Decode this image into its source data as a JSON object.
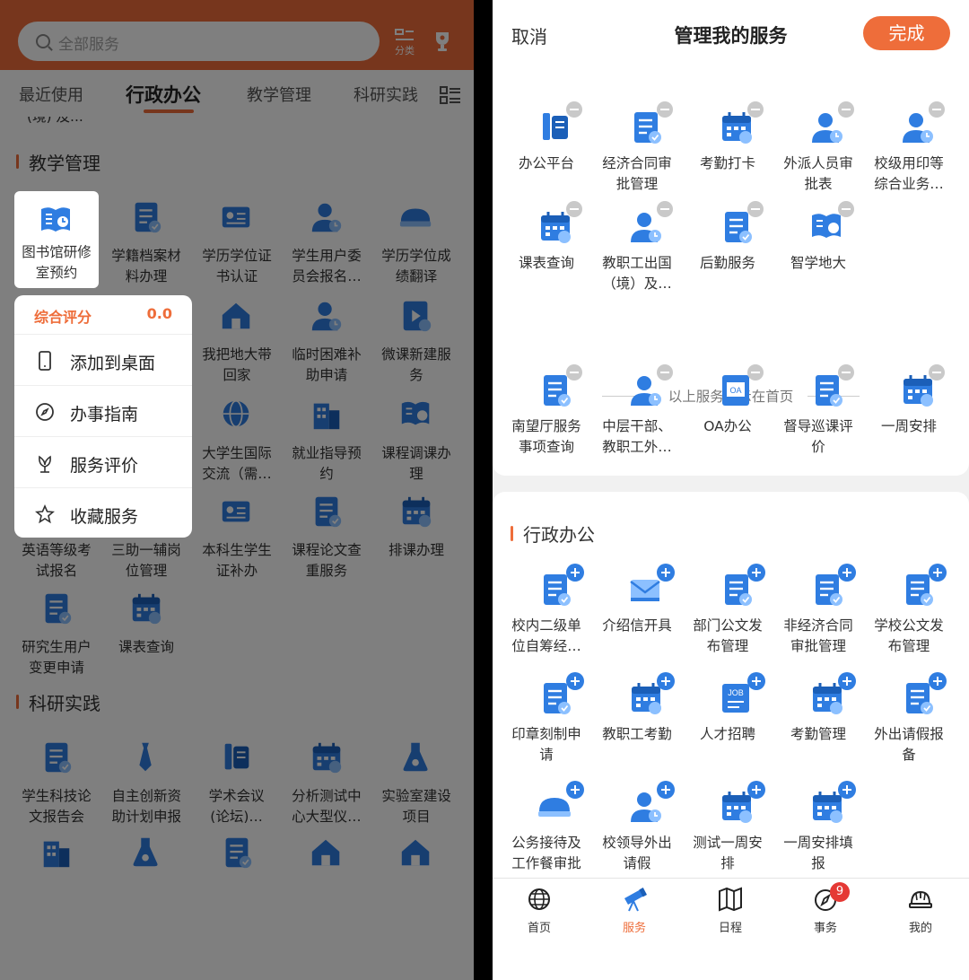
{
  "left": {
    "search_placeholder": "全部服务",
    "category_label": "分类",
    "tabs": [
      "最近使用",
      "行政办公",
      "教学管理",
      "科研实践"
    ],
    "partial_text": "(境) 及...",
    "teaching_section_title": "教学管理",
    "research_section_title": "科研实践",
    "teaching_items": [
      "学籍档案材\n料办理",
      "学历学位证\n书认证",
      "学生用户委\n员会报名…",
      "学历学位成\n绩翻译",
      "我把地大带\n回家",
      "临时困难补\n助申请",
      "微课新建服\n务",
      "大学生国际\n交流（需…",
      "就业指导预\n约",
      "课程调课办\n理",
      "英语等级考\n试报名",
      "三助一辅岗\n位管理",
      "本科生学生\n证补办",
      "课程论文查\n重服务",
      "排课办理",
      "研究生用户\n变更申请",
      "课表查询"
    ],
    "research_items": [
      "学生科技论\n文报告会",
      "自主创新资\n助计划申报",
      "学术会议\n(论坛)…",
      "分析测试中\n心大型仪…",
      "实验室建设\n项目"
    ],
    "highlight_item": "图书馆研修\n室预约",
    "popup": {
      "rating_label": "综合评分",
      "rating_value": "0.0",
      "items": [
        "添加到桌面",
        "办事指南",
        "服务评价",
        "收藏服务"
      ]
    }
  },
  "right": {
    "cancel": "取消",
    "title": "管理我的服务",
    "done": "完成",
    "my_services": [
      "办公平台",
      "经济合同审\n批管理",
      "考勤打卡",
      "外派人员审\n批表",
      "校级用印等\n综合业务…",
      "课表查询",
      "教职工出国\n（境）及…",
      "后勤服务",
      "智学地大"
    ],
    "divider_text": "以上服务显示在首页",
    "other_services": [
      "南望厅服务\n事项查询",
      "中层干部、\n教职工外…",
      "OA办公",
      "督导巡课评\n价",
      "一周安排"
    ],
    "section2_title": "行政办公",
    "section2_items": [
      "校内二级单\n位自筹经…",
      "介绍信开具",
      "部门公文发\n布管理",
      "非经济合同\n审批管理",
      "学校公文发\n布管理",
      "印章刻制申\n请",
      "教职工考勤",
      "人才招聘",
      "考勤管理",
      "外出请假报\n备",
      "公务接待及\n工作餐审批",
      "校领导外出\n请假",
      "测试一周安\n排",
      "一周安排填\n报"
    ],
    "nav": [
      "首页",
      "服务",
      "日程",
      "事务",
      "我的"
    ],
    "nav_badge": "9"
  },
  "colors": {
    "accent": "#ee6d3a",
    "icon_blue": "#2f7de1",
    "badge_red": "#e53935"
  }
}
